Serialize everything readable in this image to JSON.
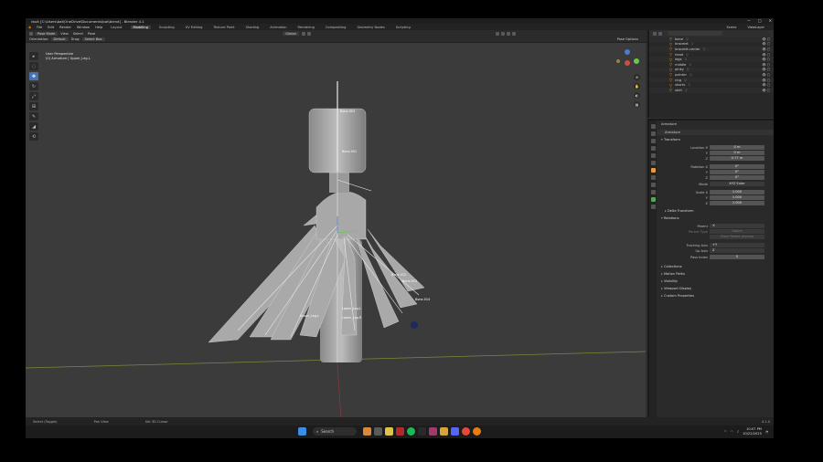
{
  "window": {
    "title": "rbult [C:\\Users\\bat\\OneDrive\\Documents\\bot\\blend] - Blender 4.1",
    "min": "—",
    "max": "□",
    "close": "✕"
  },
  "menu": {
    "items": [
      "File",
      "Edit",
      "Render",
      "Window",
      "Help"
    ],
    "workspaces": [
      "Layout",
      "Modeling",
      "Sculpting",
      "UV Editing",
      "Texture Paint",
      "Shading",
      "Animation",
      "Rendering",
      "Compositing",
      "Geometry Nodes",
      "Scripting"
    ],
    "active_workspace": "Modeling",
    "scene": "Scene",
    "view_layer": "ViewLayer"
  },
  "header": {
    "mode": "Pose Mode",
    "view": "View",
    "select": "Select",
    "pose": "Pose",
    "orientation_label": "Orientation:",
    "orientation": "Default",
    "drag_label": "Drag:",
    "drag": "Select Box",
    "transform": "Global",
    "pose_options": "Pose Options"
  },
  "viewport": {
    "line1": "User Perspective",
    "line2": "(0) Armature | Upper_Leg.L",
    "bone_labels": [
      "Bone.003",
      "Bone.001",
      "Bone.012",
      "Bone.013",
      "Bone.014",
      "Lower_Leg.L",
      "Lower_Leg.R",
      "Upper_Leg.L"
    ]
  },
  "tools": [
    "▸",
    "◌",
    "✥",
    "↻",
    "⤢",
    "⊞",
    "✎",
    "◢",
    "⟲"
  ],
  "outliner": {
    "search": "",
    "items": [
      {
        "name": "bone"
      },
      {
        "name": "bracelet"
      },
      {
        "name": "bracelet.center"
      },
      {
        "name": "head"
      },
      {
        "name": "legs"
      },
      {
        "name": "middle"
      },
      {
        "name": "pinky"
      },
      {
        "name": "pointer"
      },
      {
        "name": "ring"
      },
      {
        "name": "shorts"
      },
      {
        "name": "skirt"
      }
    ]
  },
  "properties": {
    "object": "Armature",
    "data": "Armature",
    "transform": "Transform",
    "location_x_label": "Location X",
    "location_x": "0 m",
    "location_y_label": "Y",
    "location_y": "0 m",
    "location_z_label": "Z",
    "location_z": "0.77 m",
    "rotation_x_label": "Rotation X",
    "rotation_x": "0°",
    "rotation_y_label": "Y",
    "rotation_y": "0°",
    "rotation_z_label": "Z",
    "rotation_z": "0°",
    "mode_label": "Mode",
    "mode": "XYZ Euler",
    "scale_x_label": "Scale X",
    "scale_x": "1.000",
    "scale_y_label": "Y",
    "scale_y": "1.000",
    "scale_z_label": "Z",
    "scale_z": "1.000",
    "delta": "Delta Transform",
    "relations": "Relations",
    "parent_label": "Parent",
    "parent_type_label": "Parent Type",
    "parent_type": "Object",
    "parent_inverse": "Clear Parent Inverse",
    "tracking_label": "Tracking Axis",
    "tracking": "+Y",
    "up_label": "Up Axis",
    "up": "Z",
    "pass_label": "Pass Index",
    "pass": "0",
    "collections": "Collections",
    "motion": "Motion Paths",
    "visibility": "Visibility",
    "viewport_display": "Viewport Display",
    "custom": "Custom Properties"
  },
  "status": {
    "left": "Select (Toggle)",
    "mid": "Pan View",
    "right": "Set 3D Cursor",
    "version": "4.1.0"
  },
  "taskbar": {
    "search": "Search",
    "time": "10:07 PM",
    "date": "10/22/2025"
  }
}
